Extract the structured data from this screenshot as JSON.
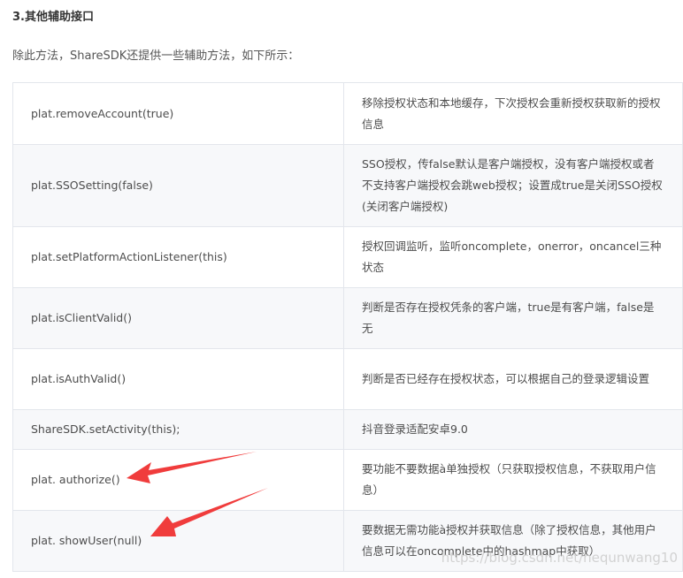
{
  "heading": "3.其他辅助接口",
  "intro": "除此方法，ShareSDK还提供一些辅助方法，如下所示：",
  "rows": [
    {
      "method": "plat.removeAccount(true)",
      "desc": "移除授权状态和本地缓存，下次授权会重新授权获取新的授权信息"
    },
    {
      "method": "plat.SSOSetting(false)",
      "desc": "SSO授权，传false默认是客户端授权，没有客户端授权或者不支持客户端授权会跳web授权；设置成true是关闭SSO授权(关闭客户端授权)"
    },
    {
      "method": "plat.setPlatformActionListener(this)",
      "desc": "授权回调监听，监听oncomplete，onerror，oncancel三种状态"
    },
    {
      "method": "plat.isClientValid()",
      "desc": "判断是否存在授权凭条的客户端，true是有客户端，false是无"
    },
    {
      "method": "plat.isAuthValid()",
      "desc": "判断是否已经存在授权状态，可以根据自己的登录逻辑设置"
    },
    {
      "method": "ShareSDK.setActivity(this);",
      "desc": "抖音登录适配安卓9.0"
    },
    {
      "method": "plat. authorize()",
      "desc": "要功能不要数据à单独授权（只获取授权信息，不获取用户信息）"
    },
    {
      "method": "plat. showUser(null)",
      "desc": "要数据无需功能à授权并获取信息（除了授权信息，其他用户信息可以在oncomplete中的hashmap中获取）"
    }
  ],
  "watermark": "https://blog.csdn.net/hequnwang10",
  "colors": {
    "arrow": "#f03c3c",
    "stripe": "#f7f8fa",
    "border": "#e3e6ec"
  }
}
